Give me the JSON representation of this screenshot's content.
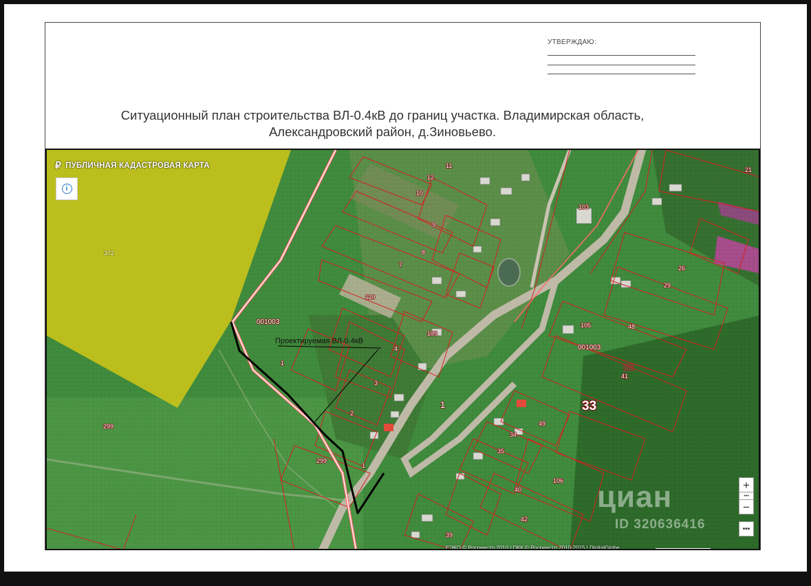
{
  "document": {
    "approval_label": "УТВЕРЖДАЮ:",
    "title_line1": "Ситуационный план строительства ВЛ-0.4кВ до границ участка. Владимирская область,",
    "title_line2": "Александровский район,  д.Зиновьево."
  },
  "map": {
    "brand": "ПУБЛИЧНАЯ КАДАСТРОВАЯ КАРТА",
    "brand_icon": "p-logo-icon",
    "info_icon": "info-icon",
    "project_label": "Проектируемая ВЛ-0.4кВ",
    "zoom_in": "+",
    "zoom_out": "−",
    "zoom_dots": "•••",
    "more": "•••",
    "copyright": "ЕЭКО © Росреестр 2010 | ПКК © Росреестр 2010-2015 | DigitalGlobe",
    "watermark": "циан",
    "watermark_id": "ID 320636416",
    "colors": {
      "boundary": "#d61f1f",
      "yellow_zone": "#c6c21a",
      "field": "#3f8a3c",
      "road": "#bfb9a8",
      "power_line": "#000000"
    },
    "labels": {
      "zone_372": "372",
      "block_001003_a": "001003",
      "block_001003_b": "001003",
      "p299_a": "299",
      "p299_b": "299",
      "p1_a": "1",
      "p1_b": "1",
      "p1_c": "1",
      "p2": "2",
      "p3": "3",
      "p4": "4",
      "p7": "7",
      "p8": "8",
      "p9": "9",
      "p10": "10",
      "p11": "11",
      "p12": "12",
      "p110": "110",
      "p109": "109",
      "p103": "103",
      "p21": "21",
      "p26": "26",
      "p29": "29",
      "p48": "48",
      "p41": "41",
      "p105": "105",
      "p33": "33",
      "p49": "49",
      "p34": "34",
      "p35": "35",
      "p106": "106",
      "p40": "40",
      "p42": "42",
      "p39": "39"
    }
  }
}
